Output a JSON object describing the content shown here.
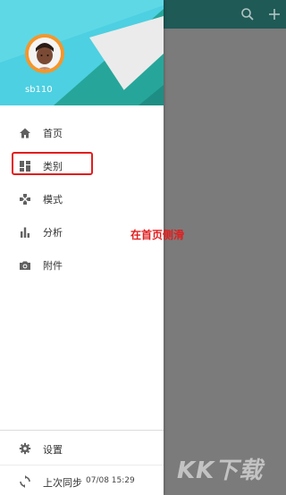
{
  "user": {
    "name": "sb110"
  },
  "menu": {
    "items": [
      {
        "label": "首页",
        "icon": "home-icon"
      },
      {
        "label": "类别",
        "icon": "dashboard-icon",
        "selected": true
      },
      {
        "label": "模式",
        "icon": "gamepad-icon"
      },
      {
        "label": "分析",
        "icon": "bar-chart-icon"
      },
      {
        "label": "附件",
        "icon": "camera-icon"
      }
    ]
  },
  "annotation": {
    "text": "在首页侧滑"
  },
  "bottom": {
    "settings_label": "设置",
    "sync_label": "上次同步",
    "sync_time": "07/08 15:29"
  },
  "watermark": {
    "text": "KK下载"
  },
  "colors": {
    "accent": "#26a69a",
    "header_light": "#4dd0e1",
    "highlight_border": "#e21d1d",
    "annotation_text": "#e21d1d"
  }
}
